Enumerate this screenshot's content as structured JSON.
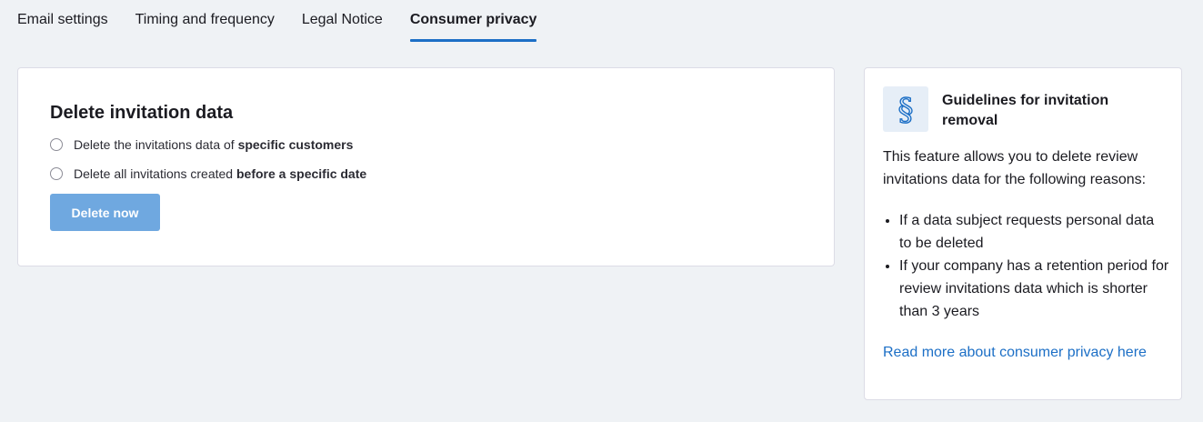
{
  "tabs": [
    {
      "label": "Email settings",
      "active": false
    },
    {
      "label": "Timing and frequency",
      "active": false
    },
    {
      "label": "Legal Notice",
      "active": false
    },
    {
      "label": "Consumer privacy",
      "active": true
    }
  ],
  "delete_card": {
    "title": "Delete invitation data",
    "options": [
      {
        "prefix": "Delete the invitations data of ",
        "emphasis": "specific customers",
        "selected": false
      },
      {
        "prefix": "Delete all invitations created ",
        "emphasis": "before a specific date",
        "selected": false
      }
    ],
    "button_label": "Delete now",
    "button_color": "#6fa8e0"
  },
  "guidelines": {
    "icon": "section-sign-icon",
    "title": "Guidelines for invitation removal",
    "description": "This feature allows you to delete review invitations data for the following reasons:",
    "reasons": [
      "If a data subject requests personal data to be deleted",
      "If your company has a retention period for review invitations data which is shorter than 3 years"
    ],
    "link_label": "Read more about consumer privacy here"
  },
  "colors": {
    "accent": "#1c6fc6",
    "background": "#eff2f5",
    "icon_bg": "#e6eef7"
  }
}
